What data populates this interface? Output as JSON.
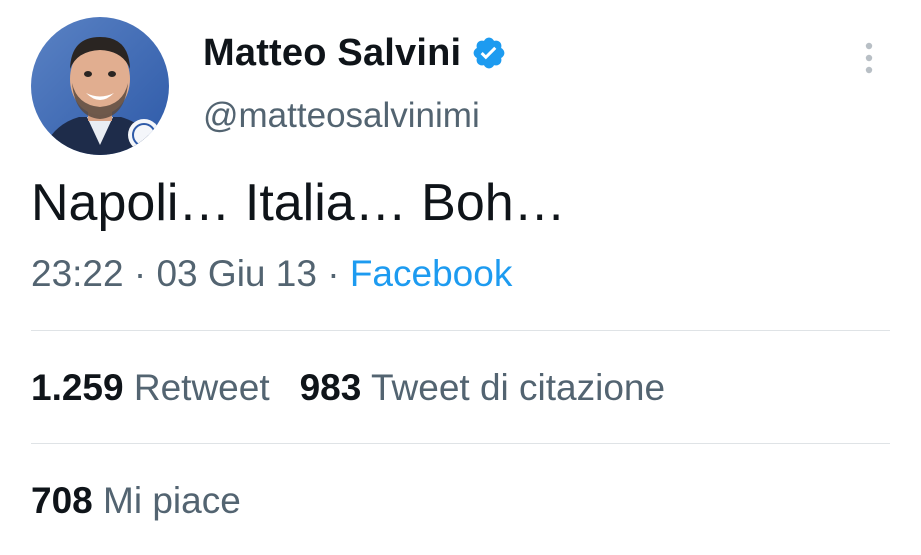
{
  "author": {
    "display_name": "Matteo Salvini",
    "handle": "@matteosalvinimi",
    "verified_icon": "verified-badge-icon",
    "avatar_icon": "profile-photo"
  },
  "tweet": {
    "text": "Napoli… Italia… Boh…",
    "time": "23:22",
    "separator": "·",
    "date": "03 Giu 13",
    "source": "Facebook"
  },
  "stats": {
    "retweets_value": "1.259",
    "retweets_label": "Retweet",
    "quotes_value": "983",
    "quotes_label": "Tweet di citazione",
    "likes_value": "708",
    "likes_label": "Mi piace"
  },
  "colors": {
    "text_primary": "#0f1419",
    "text_secondary": "#536471",
    "accent": "#1d9bf0",
    "divider": "#dfe3e6"
  }
}
